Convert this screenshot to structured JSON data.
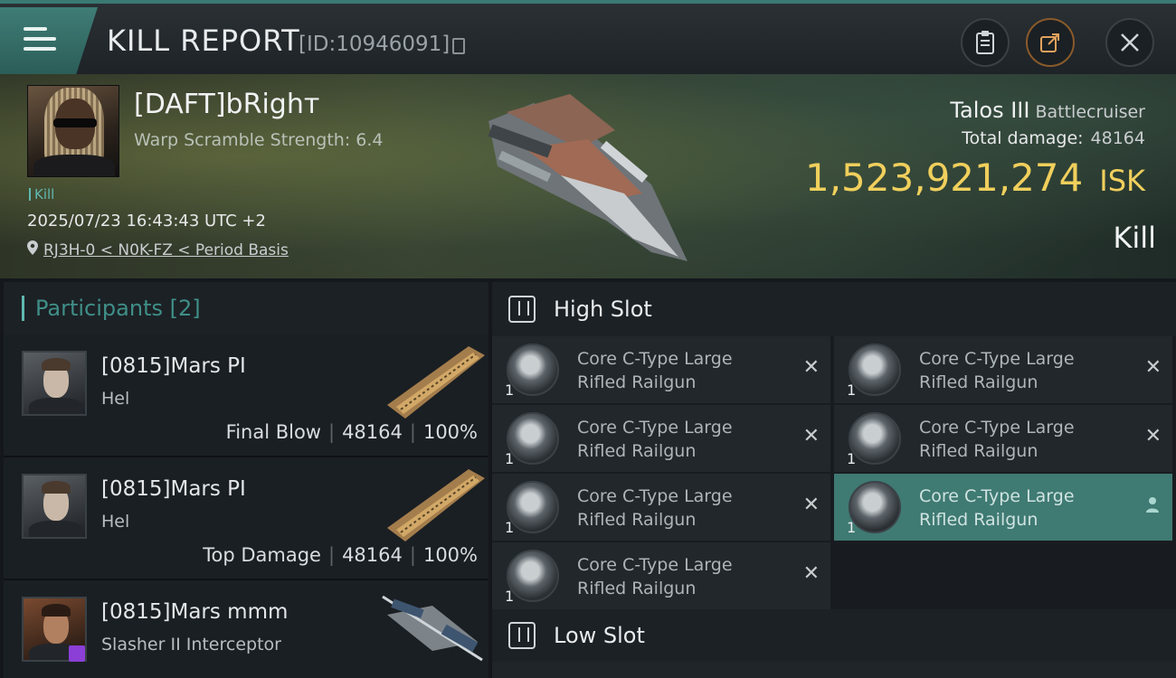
{
  "header": {
    "title": "KILL REPORT",
    "report_id": "[ID:10946091]"
  },
  "victim": {
    "name": "[DAFT]bRighт",
    "scram": "Warp Scramble Strength: 6.4",
    "tag": "Kill",
    "datetime": "2025/07/23 16:43:43 UTC +2",
    "location": "RJ3H-0 < N0K-FZ < Period Basis"
  },
  "summary": {
    "ship": "Talos III",
    "ship_class": "Battlecruiser",
    "total_damage_label": "Total damage:",
    "total_damage": "48164",
    "isk_value": "1,523,921,274",
    "isk_unit": "ISK",
    "result": "Kill"
  },
  "participants": {
    "title": "Participants [2]",
    "rows": [
      {
        "name": "[0815]Mars PI",
        "ship": "Hel",
        "role": "Final Blow",
        "damage": "48164",
        "percent": "100%"
      },
      {
        "name": "[0815]Mars PI",
        "ship": "Hel",
        "role": "Top Damage",
        "damage": "48164",
        "percent": "100%"
      },
      {
        "name": "[0815]Mars mmm",
        "ship": "Slasher II Interceptor",
        "role": "",
        "damage": "",
        "percent": ""
      }
    ]
  },
  "fitting": {
    "high_slot_label": "High Slot",
    "low_slot_label": "Low Slot",
    "modules": [
      {
        "line1": "Core C-Type Large",
        "line2": "Rifled Railgun",
        "qty": "1",
        "state": "destroyed"
      },
      {
        "line1": "Core C-Type Large",
        "line2": "Rifled Railgun",
        "qty": "1",
        "state": "destroyed"
      },
      {
        "line1": "Core C-Type Large",
        "line2": "Rifled Railgun",
        "qty": "1",
        "state": "destroyed"
      },
      {
        "line1": "Core C-Type Large",
        "line2": "Rifled Railgun",
        "qty": "1",
        "state": "destroyed"
      },
      {
        "line1": "Core C-Type Large",
        "line2": "Rifled Railgun",
        "qty": "1",
        "state": "destroyed"
      },
      {
        "line1": "Core C-Type Large",
        "line2": "Rifled Railgun",
        "qty": "1",
        "state": "dropped"
      },
      {
        "line1": "Core C-Type Large",
        "line2": "Rifled Railgun",
        "qty": "1",
        "state": "destroyed"
      }
    ]
  },
  "colors": {
    "accent_teal": "#3f7a73",
    "isk_gold": "#f0cf5c",
    "bg_dark": "#14181c"
  },
  "icons": [
    "menu-icon",
    "copy-icon",
    "clipboard-icon",
    "share-icon",
    "close-icon",
    "location-pin-icon",
    "high-slot-icon",
    "low-slot-icon",
    "module-destroyed-icon",
    "module-dropped-icon"
  ]
}
